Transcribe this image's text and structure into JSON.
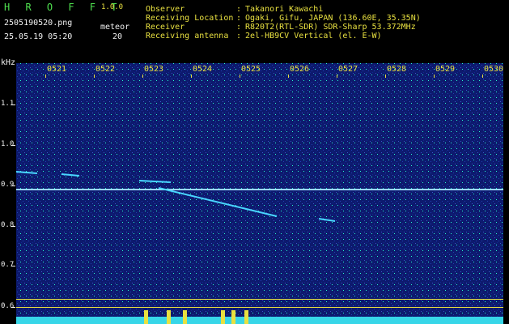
{
  "header": {
    "logo": "H R O F F T",
    "version": "1.0.0",
    "filename": "2505190520.png",
    "datetime": "25.05.19 05:20",
    "detection_label": "meteor",
    "detection_count": "20",
    "info": [
      {
        "label": "Observer",
        "value": "Takanori Kawachi"
      },
      {
        "label": "Receiving Location",
        "value": "Ogaki, Gifu, JAPAN (136.60E, 35.35N)"
      },
      {
        "label": "Receiver",
        "value": "R820T2(RTL-SDR) SDR-Sharp 53.372MHz"
      },
      {
        "label": "Receiving antenna",
        "value": "2el-HB9CV Vertical (el. E-W)"
      }
    ]
  },
  "plot": {
    "y_unit": "kHz",
    "y_ticks": [
      "1.1",
      "1.0",
      "0.9",
      "0.8",
      "0.7",
      "0.6"
    ],
    "time_labels": [
      "0521",
      "0522",
      "0523",
      "0524",
      "0525",
      "0526",
      "0527",
      "0528",
      "0529",
      "0530"
    ],
    "colors": {
      "background": "#0d1a6e",
      "carrier": "#9ad7ff",
      "echo": "#49d6ff",
      "activity": "#e8e040"
    }
  }
}
